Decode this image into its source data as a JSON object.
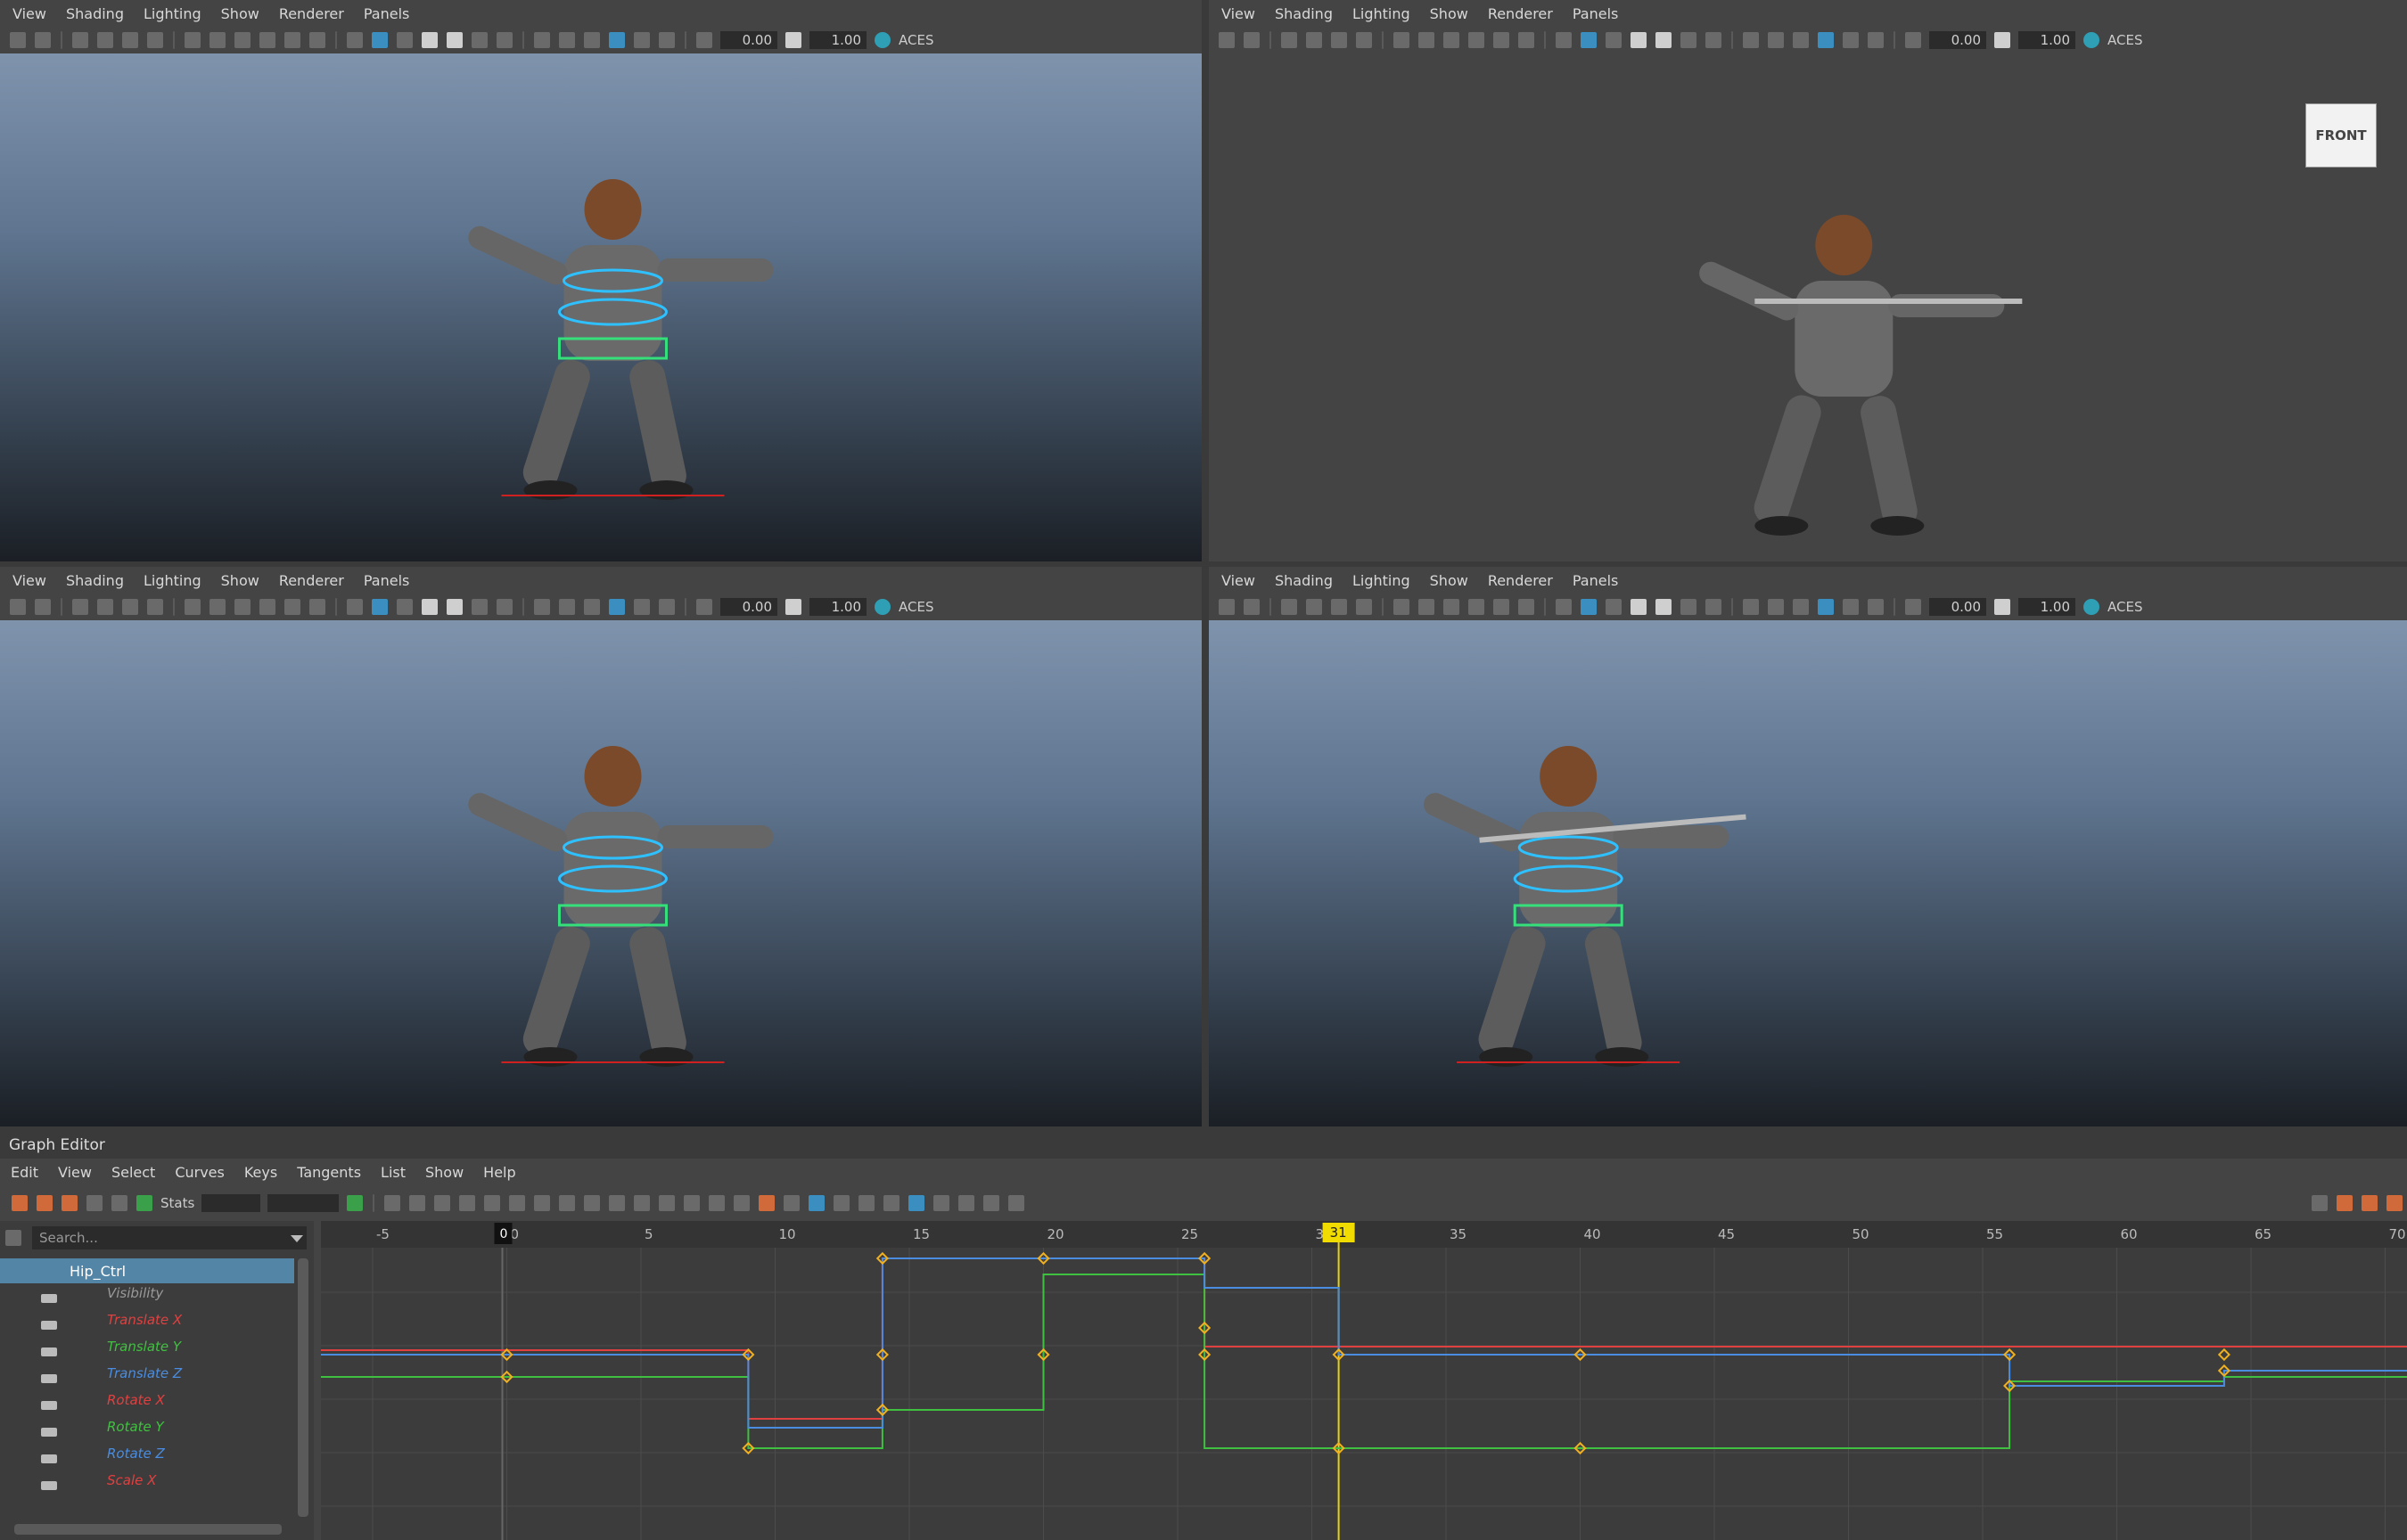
{
  "viewport_menu": [
    "View",
    "Shading",
    "Lighting",
    "Show",
    "Renderer",
    "Panels"
  ],
  "toolbar_values": {
    "exposure": "0.00",
    "gamma": "1.00",
    "color_space": "ACES"
  },
  "viewcube_label": "FRONT",
  "graph_editor": {
    "title": "Graph Editor",
    "menu": [
      "Edit",
      "View",
      "Select",
      "Curves",
      "Keys",
      "Tangents",
      "List",
      "Show",
      "Help"
    ],
    "stats_label": "Stats",
    "search_placeholder": "Search...",
    "node": "Hip_Ctrl",
    "attributes": [
      {
        "name": "Visibility",
        "color": "#9a9a9a"
      },
      {
        "name": "Translate X",
        "color": "#e04040"
      },
      {
        "name": "Translate Y",
        "color": "#40c040"
      },
      {
        "name": "Translate Z",
        "color": "#4a8de0"
      },
      {
        "name": "Rotate X",
        "color": "#e04040"
      },
      {
        "name": "Rotate Y",
        "color": "#40c040"
      },
      {
        "name": "Rotate Z",
        "color": "#4a8de0"
      },
      {
        "name": "Scale X",
        "color": "#e04040"
      }
    ],
    "timeline_ticks": [
      "-5",
      "0",
      "5",
      "10",
      "15",
      "20",
      "25",
      "30",
      "35",
      "40",
      "45",
      "50",
      "55",
      "60",
      "65",
      "70"
    ],
    "start_marker": "0",
    "current_frame": "31"
  }
}
